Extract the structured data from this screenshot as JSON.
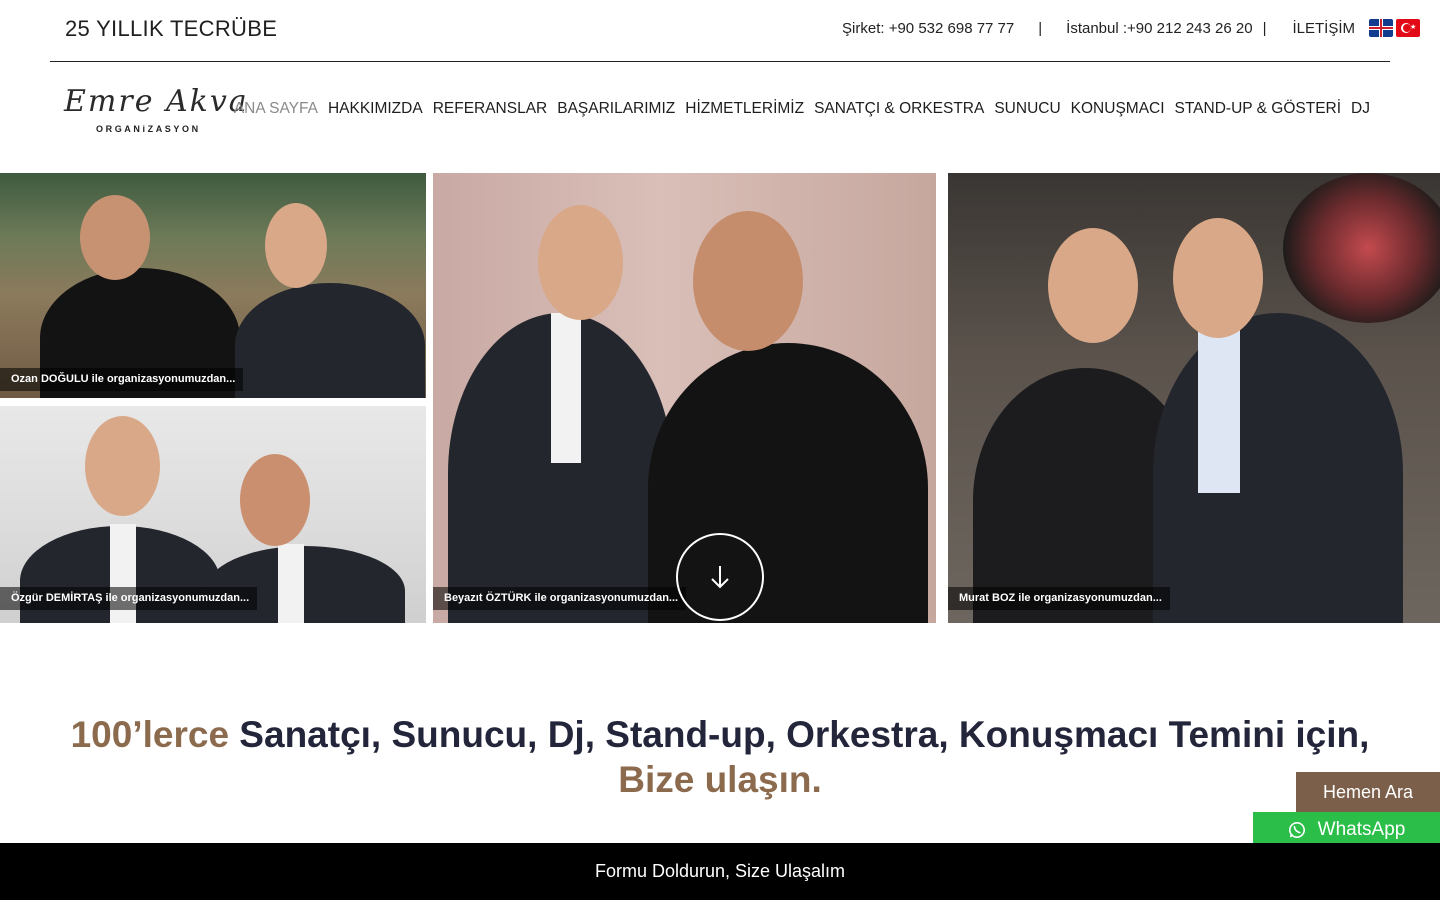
{
  "topbar": {
    "tagline": "25 YILLIK TECRÜBE",
    "company_phone": "Şirket: +90 532 698 77 77",
    "separator": "|",
    "istanbul_phone": "İstanbul :+90 212 243 26 20",
    "contact_link": "İLETİŞİM",
    "flags": [
      "uk-flag-icon",
      "turkey-flag-icon"
    ]
  },
  "logo": {
    "script": "Emre Akva",
    "subtitle": "ORGANiZASYON"
  },
  "nav": {
    "items": [
      {
        "label": "ANA SAYFA",
        "active": true
      },
      {
        "label": "HAKKIMIZDA"
      },
      {
        "label": "REFERANSLAR"
      },
      {
        "label": "BAŞARILARIMIZ"
      },
      {
        "label": "HİZMETLERİMİZ"
      },
      {
        "label": "SANATÇI & ORKESTRA"
      },
      {
        "label": "SUNUCU"
      },
      {
        "label": "KONUŞMACI"
      },
      {
        "label": "STAND-UP & GÖSTERİ"
      },
      {
        "label": "DJ"
      }
    ]
  },
  "gallery": {
    "tiles": [
      {
        "caption": "Ozan DOĞULU ile organizasyonumuzdan..."
      },
      {
        "caption": "Özgür DEMİRTAŞ ile organizasyonumuzdan..."
      },
      {
        "caption": "Beyazıt ÖZTÜRK ile organizasyonumuzdan..."
      },
      {
        "caption": "Murat BOZ ile organizasyonumuzdan..."
      }
    ],
    "scroll_icon": "arrow-down-icon"
  },
  "headline": {
    "accent_start": "100’lerce",
    "main": " Sanatçı, Sunucu, Dj, Stand-up, Orkestra, Konuşmacı Temini için,",
    "accent_end": "Bize ulaşın."
  },
  "floating": {
    "call_label": "Hemen Ara",
    "whatsapp_label": "WhatsApp",
    "whatsapp_icon": "whatsapp-icon"
  },
  "formbar": {
    "label": "Formu Doldurun, Size Ulaşalım"
  },
  "colors": {
    "accent": "#8b6a4d",
    "headline": "#23263a",
    "call_button": "#7b5f4a",
    "whatsapp": "#2bbf4a"
  }
}
